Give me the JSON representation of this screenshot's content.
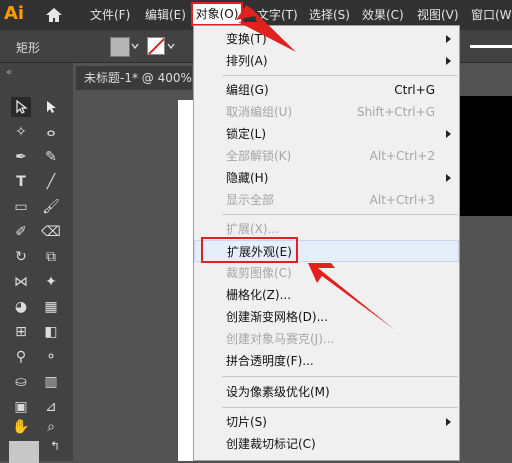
{
  "app": {
    "logo": "Ai"
  },
  "menubar": {
    "items": [
      {
        "label": "文件(F)"
      },
      {
        "label": "编辑(E)"
      },
      {
        "label": "对象(O)"
      },
      {
        "label": "文字(T)"
      },
      {
        "label": "选择(S)"
      },
      {
        "label": "效果(C)"
      },
      {
        "label": "视图(V)"
      },
      {
        "label": "窗口(W"
      }
    ]
  },
  "controlbar": {
    "label": "矩形"
  },
  "toolbar": {
    "collapse_label": "«",
    "swap_label": "↰"
  },
  "document": {
    "tab_label": "未标题-1* @ 400%"
  },
  "dropdown": {
    "items": [
      {
        "label": "变换(T)",
        "shortcut": "",
        "submenu": true,
        "disabled": false
      },
      {
        "label": "排列(A)",
        "shortcut": "",
        "submenu": true,
        "disabled": false
      },
      {
        "label": "编组(G)",
        "shortcut": "Ctrl+G",
        "submenu": false,
        "disabled": false
      },
      {
        "label": "取消编组(U)",
        "shortcut": "Shift+Ctrl+G",
        "submenu": false,
        "disabled": true
      },
      {
        "label": "锁定(L)",
        "shortcut": "",
        "submenu": true,
        "disabled": false
      },
      {
        "label": "全部解锁(K)",
        "shortcut": "Alt+Ctrl+2",
        "submenu": false,
        "disabled": true
      },
      {
        "label": "隐藏(H)",
        "shortcut": "",
        "submenu": true,
        "disabled": false
      },
      {
        "label": "显示全部",
        "shortcut": "Alt+Ctrl+3",
        "submenu": false,
        "disabled": true
      },
      {
        "label": "扩展(X)...",
        "shortcut": "",
        "submenu": false,
        "disabled": true
      },
      {
        "label": "扩展外观(E)",
        "shortcut": "",
        "submenu": false,
        "disabled": false
      },
      {
        "label": "裁剪图像(C)",
        "shortcut": "",
        "submenu": false,
        "disabled": true
      },
      {
        "label": "栅格化(Z)...",
        "shortcut": "",
        "submenu": false,
        "disabled": false
      },
      {
        "label": "创建渐变网格(D)...",
        "shortcut": "",
        "submenu": false,
        "disabled": false
      },
      {
        "label": "创建对象马赛克(J)...",
        "shortcut": "",
        "submenu": false,
        "disabled": true
      },
      {
        "label": "拼合透明度(F)...",
        "shortcut": "",
        "submenu": false,
        "disabled": false
      },
      {
        "label": "设为像素级优化(M)",
        "shortcut": "",
        "submenu": false,
        "disabled": false
      },
      {
        "label": "切片(S)",
        "shortcut": "",
        "submenu": true,
        "disabled": false
      },
      {
        "label": "创建裁切标记(C)",
        "shortcut": "",
        "submenu": false,
        "disabled": false
      }
    ]
  },
  "colors": {
    "highlight_red": "#e0211e",
    "menu_bg": "#f0f0f0",
    "ui_dark": "#323232"
  }
}
